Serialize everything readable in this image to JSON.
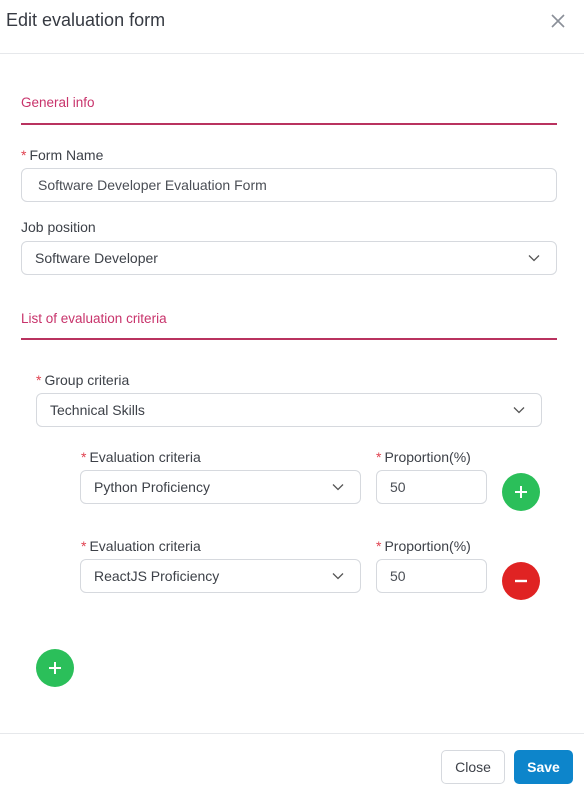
{
  "dialog": {
    "title": "Edit evaluation form",
    "close_icon": "close-x-icon"
  },
  "general_info": {
    "section_title": "General info",
    "form_name": {
      "label": "Form Name",
      "required": "*",
      "value": "Software Developer Evaluation Form"
    },
    "job_position": {
      "label": "Job position",
      "value": "Software Developer"
    }
  },
  "criteria_section": {
    "section_title": "List of evaluation criteria",
    "group": {
      "label": "Group criteria",
      "required": "*",
      "value": "Technical Skills"
    },
    "items": [
      {
        "criteria_label": "Evaluation criteria",
        "criteria_value": "Python Proficiency",
        "proportion_label": "Proportion(%)",
        "proportion_value": "50",
        "required": "*",
        "action": "add"
      },
      {
        "criteria_label": "Evaluation criteria",
        "criteria_value": "ReactJS Proficiency",
        "proportion_label": "Proportion(%)",
        "proportion_value": "50",
        "required": "*",
        "action": "remove"
      }
    ],
    "add_group_icon": "plus-icon"
  },
  "footer": {
    "close_label": "Close",
    "save_label": "Save"
  },
  "colors": {
    "accent": "#c8336b",
    "add": "#2bbf5a",
    "remove": "#e02323",
    "primary": "#0d85cb"
  }
}
